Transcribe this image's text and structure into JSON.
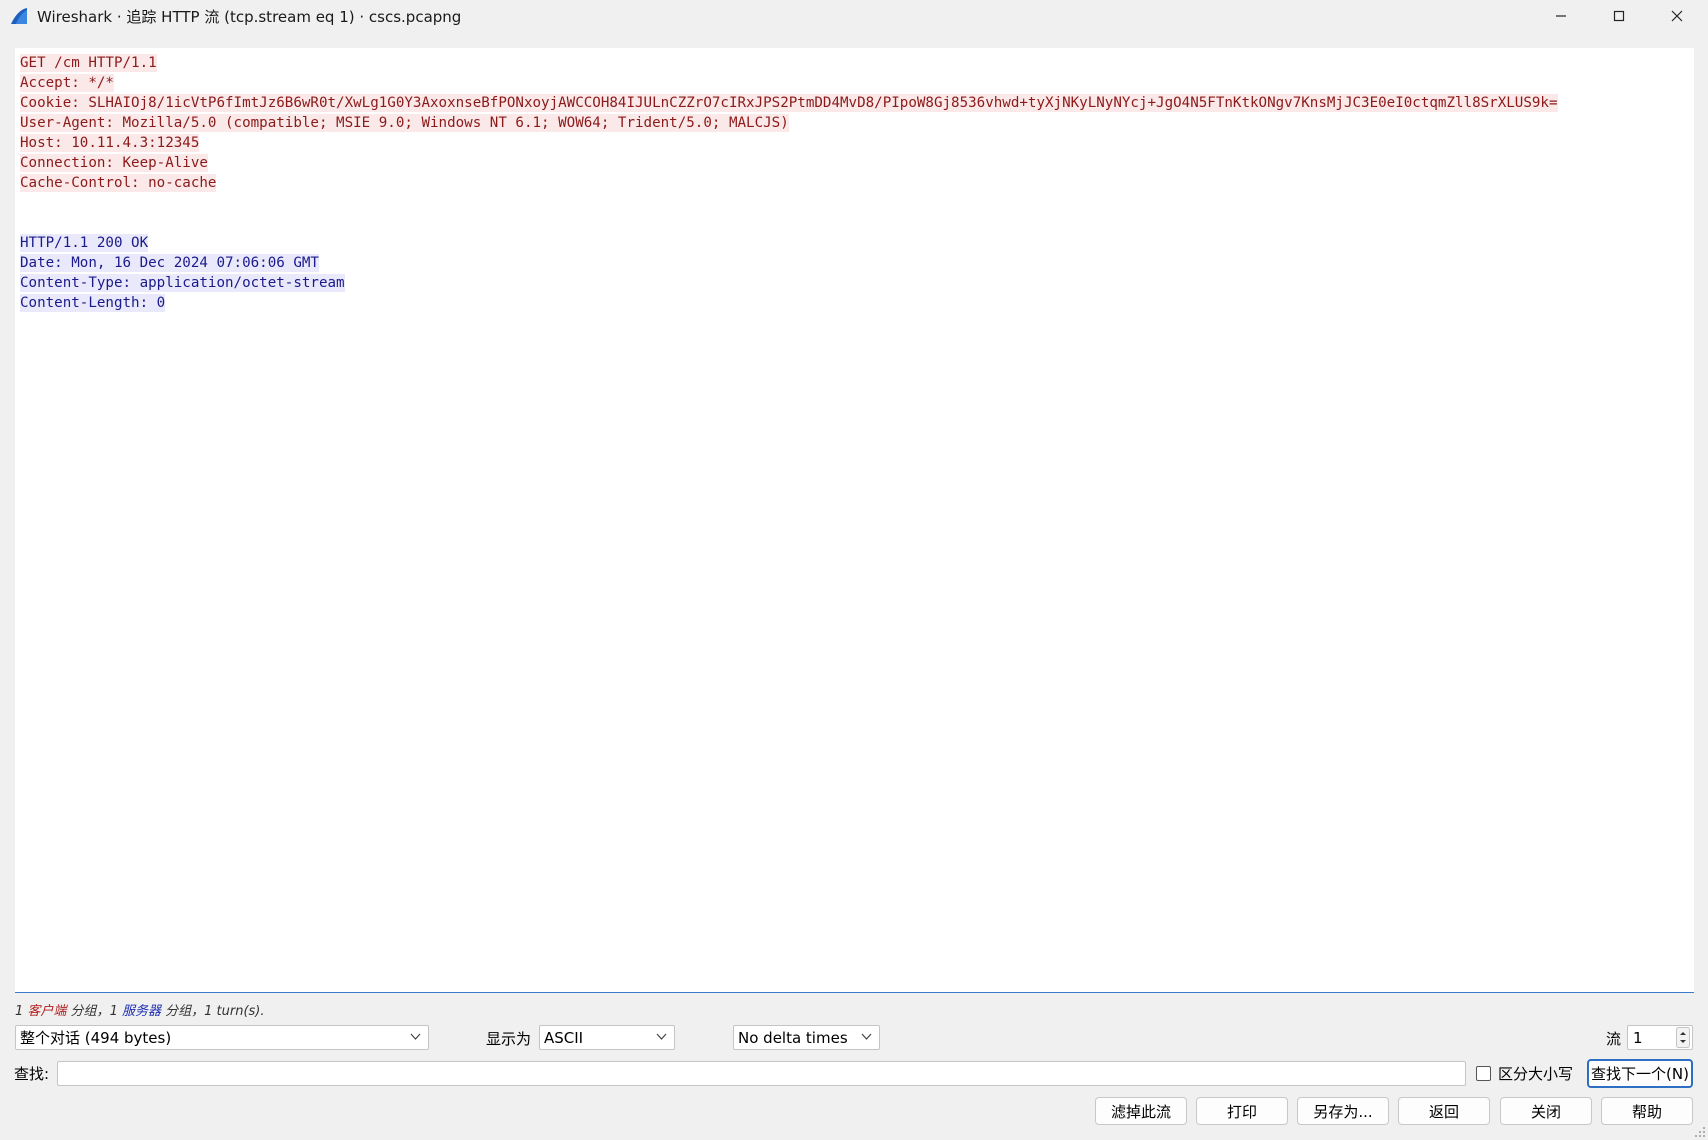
{
  "window": {
    "title": "Wireshark · 追踪 HTTP 流 (tcp.stream eq 1) · cscs.pcapng",
    "icon": "wireshark-fin-icon"
  },
  "stream": {
    "client_lines": [
      "GET /cm HTTP/1.1",
      "Accept: */*",
      "Cookie: SLHAIOj8/1icVtP6fImtJz6B6wR0t/XwLg1G0Y3AxoxnseBfPONxoyjAWCCOH84IJULnCZZrO7cIRxJPS2PtmDD4MvD8/PIpoW8Gj8536vhwd+tyXjNKyLNyNYcj+JgO4N5FTnKtkONgv7KnsMjJC3E0eI0ctqmZll8SrXLUS9k=",
      "User-Agent: Mozilla/5.0 (compatible; MSIE 9.0; Windows NT 6.1; WOW64; Trident/5.0; MALCJS)",
      "Host: 10.11.4.3:12345",
      "Connection: Keep-Alive",
      "Cache-Control: no-cache"
    ],
    "server_lines": [
      "HTTP/1.1 200 OK",
      "Date: Mon, 16 Dec 2024 07:06:06 GMT",
      "Content-Type: application/octet-stream",
      "Content-Length: 0"
    ],
    "client_color": "#8b1a1a",
    "client_bg": "#fbe9e9",
    "server_color": "#1a1a8b",
    "server_bg": "#e9e9fb"
  },
  "summary": {
    "client_count": "1 ",
    "client_word": "客户端",
    "client_suffix": " 分组，",
    "server_count": "1 ",
    "server_word": "服务器",
    "server_suffix": " 分组，",
    "turns": "1 turn(s)."
  },
  "controls": {
    "conversation": "整个对话 (494 bytes)",
    "show_as_label": "显示为",
    "encoding": "ASCII",
    "delta": "No delta times",
    "stream_label": "流",
    "stream_value": "1"
  },
  "find": {
    "label": "查找:",
    "value": "",
    "case_label": "区分大小写",
    "next_button": "查找下一个(N)"
  },
  "buttons": {
    "filter_out": "滤掉此流",
    "print": "打印",
    "save_as": "另存为...",
    "back": "返回",
    "close": "关闭",
    "help": "帮助"
  }
}
